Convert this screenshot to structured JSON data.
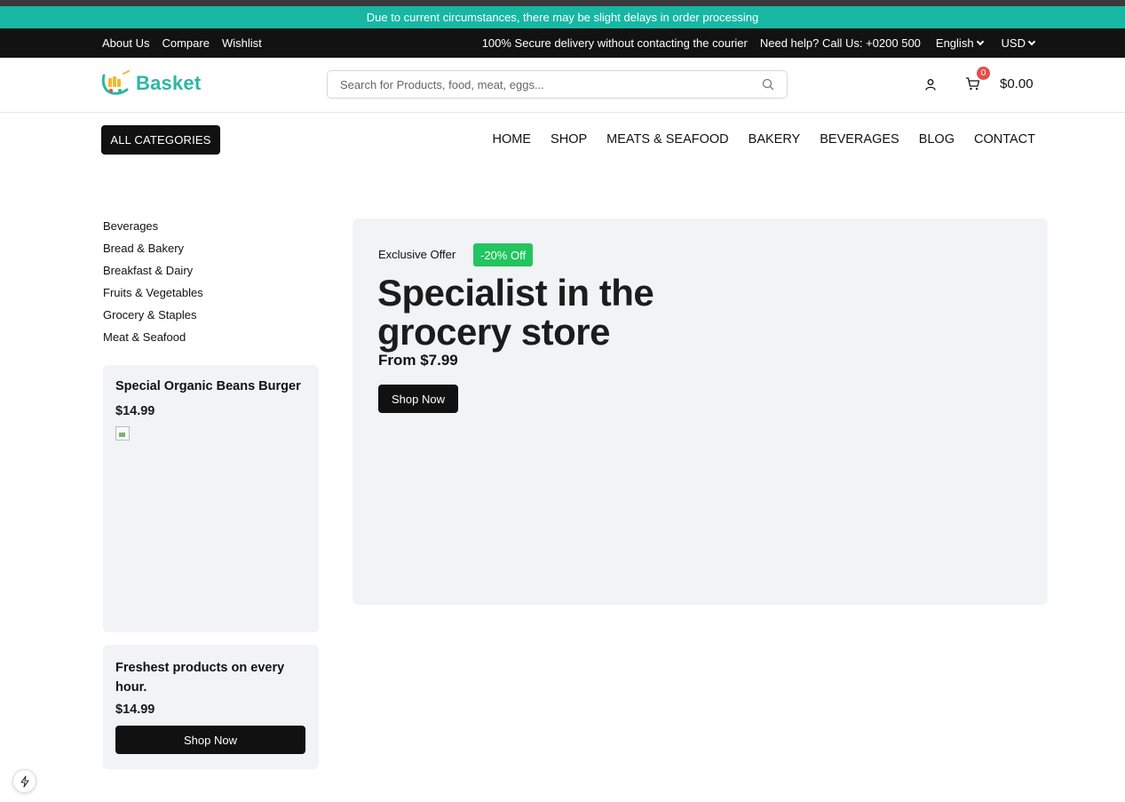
{
  "announcement": "Due to current circumstances, there may be slight delays in order processing",
  "topbar": {
    "links": [
      "About Us",
      "Compare",
      "Wishlist"
    ],
    "secure": "100% Secure delivery without contacting the courier",
    "help": "Need help? Call Us: +0200 500",
    "language": "English",
    "currency": "USD"
  },
  "header": {
    "logo_text": "Basket",
    "search_placeholder": "Search for Products, food, meat, eggs...",
    "cart_count": "0",
    "cart_total": "$0.00"
  },
  "nav": {
    "all_categories": "ALL CATEGORIES",
    "items": [
      "HOME",
      "SHOP",
      "MEATS & SEAFOOD",
      "BAKERY",
      "BEVERAGES",
      "BLOG",
      "CONTACT"
    ]
  },
  "categories": [
    "Beverages",
    "Bread & Bakery",
    "Breakfast & Dairy",
    "Fruits & Vegetables",
    "Grocery & Staples",
    "Meat & Seafood"
  ],
  "promo1": {
    "title": "Special Organic Beans Burger",
    "price": "$14.99"
  },
  "promo2": {
    "title": "Freshest products on every hour.",
    "price": "$14.99",
    "button": "Shop Now"
  },
  "hero": {
    "offer": "Exclusive Offer",
    "badge": "-20% Off",
    "title": "Specialist in the grocery store",
    "from": "From $7.99",
    "button": "Shop Now"
  },
  "colors": {
    "accent": "#17b7a4",
    "dark": "#121212",
    "badge_green": "#22c55e",
    "cart_badge": "#e84c4c"
  }
}
